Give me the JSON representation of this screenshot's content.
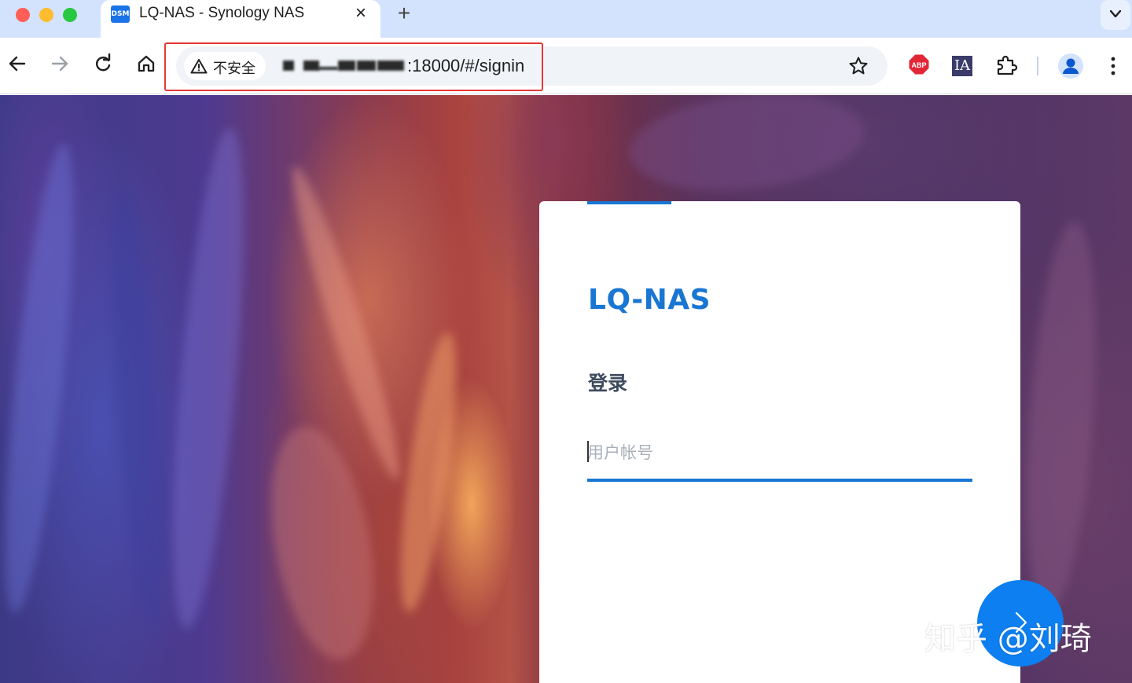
{
  "browser": {
    "tab": {
      "favicon_text": "DSM",
      "title": "LQ-NAS - Synology NAS",
      "close_glyph": "×"
    },
    "new_tab_glyph": "+",
    "toolbar": {
      "security_chip": "不安全",
      "url_visible": ":18000/#/signin",
      "url_redacted": true
    },
    "extensions": [
      {
        "name": "adblock-plus-icon",
        "label": "ABP"
      },
      {
        "name": "internet-archive-icon",
        "label": "IA"
      },
      {
        "name": "extensions-puzzle-icon",
        "label": ""
      }
    ],
    "colors": {
      "tabstrip": "#d3e3fd",
      "omnibox": "#f0f4f9",
      "highlight": "#e53935"
    }
  },
  "login": {
    "hostname": "LQ-NAS",
    "heading": "登录",
    "username_placeholder": "用户帐号",
    "username_value": "",
    "next_icon": "arrow-right-icon",
    "accent_color": "#1976d2"
  },
  "watermark": "知乎 @刘琦"
}
